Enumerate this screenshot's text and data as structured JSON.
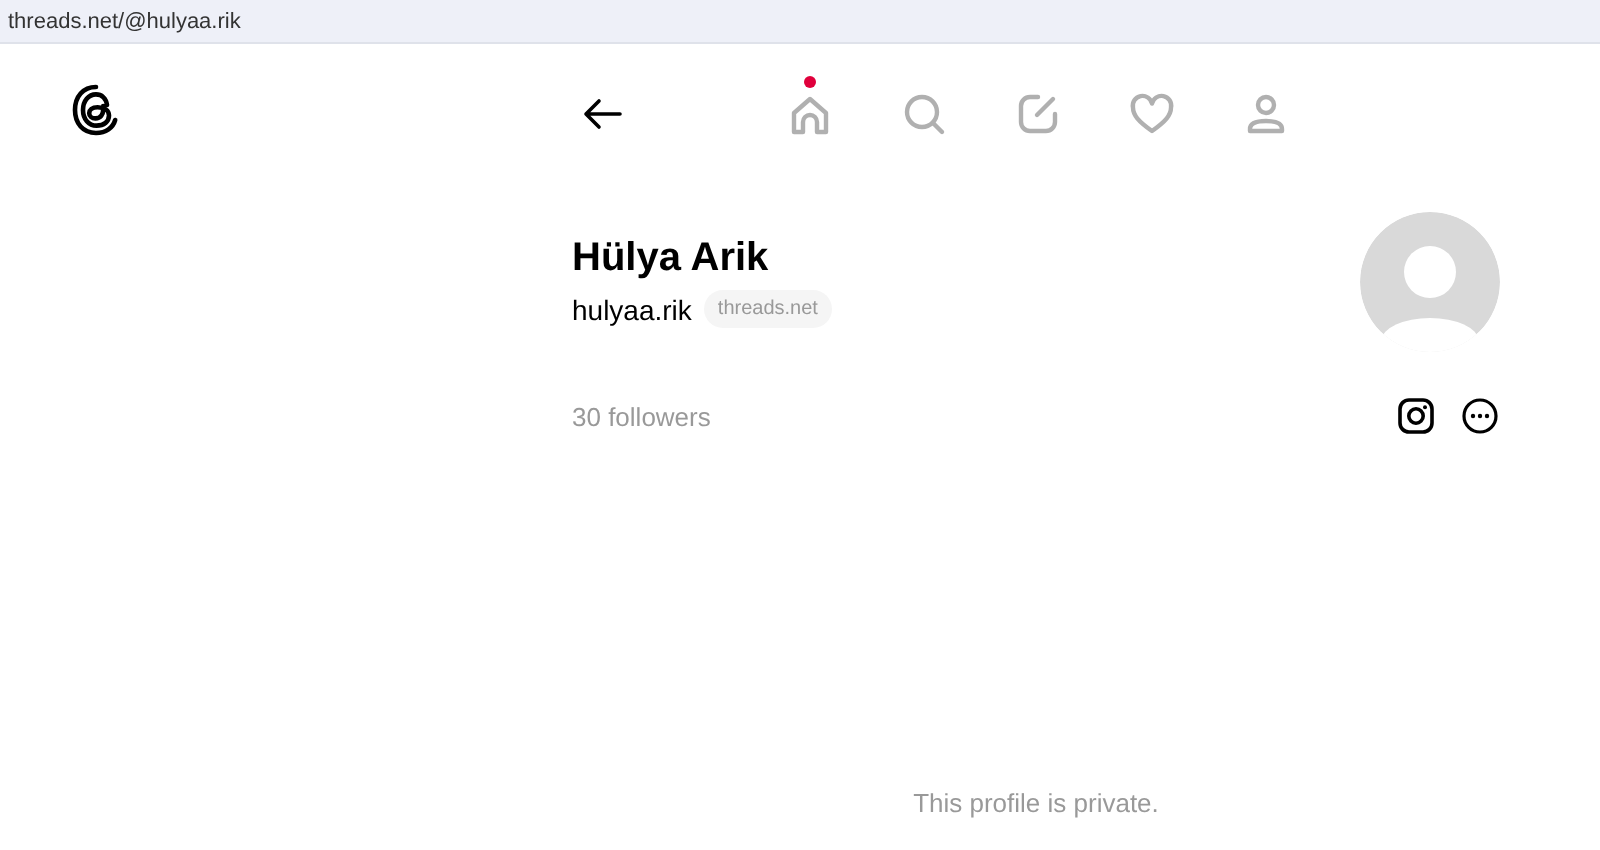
{
  "address_bar": {
    "url": "threads.net/@hulyaa.rik"
  },
  "nav": [
    {
      "kind": "home",
      "notification": true
    },
    {
      "kind": "search",
      "notification": false
    },
    {
      "kind": "compose",
      "notification": false
    },
    {
      "kind": "heart",
      "notification": false
    },
    {
      "kind": "profile",
      "notification": false
    }
  ],
  "profile": {
    "name": "Hülya Arik",
    "handle": "hulyaa.rik",
    "domain_badge": "threads.net",
    "followers": "30 followers"
  },
  "private_notice": "This profile is private."
}
